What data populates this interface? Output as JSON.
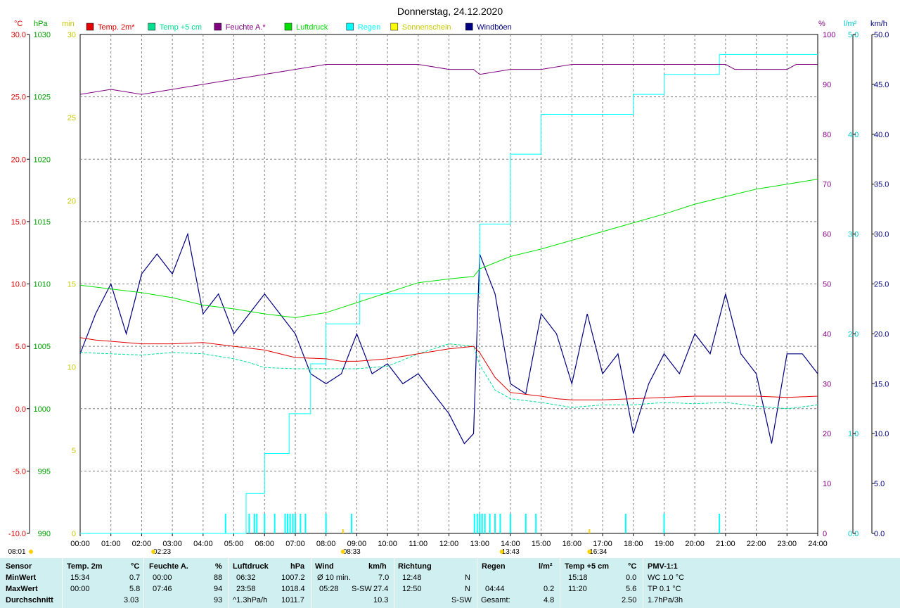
{
  "title": "Donnerstag, 24.12.2020",
  "legend": [
    {
      "label": "Temp. 2m*",
      "color": "#e00000"
    },
    {
      "label": "Temp +5 cm",
      "color": "#00e090"
    },
    {
      "label": "Feuchte A.*",
      "color": "#800080"
    },
    {
      "label": "Luftdruck",
      "color": "#00e000"
    },
    {
      "label": "Regen",
      "color": "#00ffff"
    },
    {
      "label": "Sonnenschein",
      "color": "#ffff00"
    },
    {
      "label": "Windböen",
      "color": "#000080"
    }
  ],
  "units": {
    "temp": "°C",
    "pressure": "hPa",
    "sun": "min",
    "humidity": "%",
    "rain": "l/m²",
    "wind": "km/h"
  },
  "axes": {
    "temp_ticks": [
      "30.0",
      "25.0",
      "20.0",
      "15.0",
      "10.0",
      "5.0",
      "0.0",
      "-5.0",
      "-10.0"
    ],
    "pressure_ticks": [
      "1030",
      "1025",
      "1020",
      "1015",
      "1010",
      "1005",
      "1000",
      "995",
      "990"
    ],
    "sun_ticks": [
      "30",
      "25",
      "20",
      "15",
      "10",
      "5",
      "0"
    ],
    "humidity_ticks": [
      "100",
      "90",
      "80",
      "70",
      "60",
      "50",
      "40",
      "30",
      "20",
      "10",
      "0"
    ],
    "rain_ticks": [
      "5.0",
      "4.0",
      "3.0",
      "2.0",
      "1.0",
      "0.0"
    ],
    "wind_ticks": [
      "50.0",
      "45.0",
      "40.0",
      "35.0",
      "30.0",
      "25.0",
      "20.0",
      "15.0",
      "10.0",
      "5.0",
      "0.0"
    ],
    "time_ticks": [
      "00:00",
      "01:00",
      "02:00",
      "03:00",
      "04:00",
      "05:00",
      "06:00",
      "07:00",
      "08:00",
      "09:00",
      "10:00",
      "11:00",
      "12:00",
      "13:00",
      "14:00",
      "15:00",
      "16:00",
      "17:00",
      "18:00",
      "19:00",
      "20:00",
      "21:00",
      "22:00",
      "23:00",
      "24:00"
    ]
  },
  "time_markers": [
    {
      "label": "08:01",
      "hour": -1
    },
    {
      "label": "02:23",
      "hour": 2.38
    },
    {
      "label": "08:33",
      "hour": 8.55
    },
    {
      "label": "13:43",
      "hour": 13.72
    },
    {
      "label": "16:34",
      "hour": 16.57
    }
  ],
  "chart_data": {
    "type": "line",
    "title": "Donnerstag, 24.12.2020",
    "x_range": [
      "00:00",
      "24:00"
    ],
    "series": [
      {
        "name": "Temp. 2m*",
        "unit": "°C",
        "points": [
          [
            0,
            5.7
          ],
          [
            0.5,
            5.5
          ],
          [
            1,
            5.4
          ],
          [
            2,
            5.2
          ],
          [
            3,
            5.2
          ],
          [
            4,
            5.3
          ],
          [
            5,
            5.0
          ],
          [
            6,
            4.7
          ],
          [
            7,
            4.1
          ],
          [
            8,
            4.0
          ],
          [
            8.5,
            3.8
          ],
          [
            9,
            3.8
          ],
          [
            10,
            4.0
          ],
          [
            11,
            4.4
          ],
          [
            12,
            4.8
          ],
          [
            12.8,
            5.0
          ],
          [
            13,
            4.5
          ],
          [
            13.5,
            2.5
          ],
          [
            14,
            1.3
          ],
          [
            15,
            1.0
          ],
          [
            15.5,
            0.8
          ],
          [
            16,
            0.7
          ],
          [
            17,
            0.7
          ],
          [
            18,
            0.8
          ],
          [
            19,
            0.9
          ],
          [
            20,
            1.0
          ],
          [
            21,
            1.0
          ],
          [
            22,
            1.0
          ],
          [
            23,
            0.9
          ],
          [
            24,
            1.0
          ]
        ]
      },
      {
        "name": "Temp +5 cm",
        "unit": "°C",
        "points": [
          [
            0,
            4.5
          ],
          [
            1,
            4.4
          ],
          [
            2,
            4.3
          ],
          [
            3,
            4.5
          ],
          [
            4,
            4.4
          ],
          [
            5,
            4.0
          ],
          [
            5.5,
            3.7
          ],
          [
            6,
            3.3
          ],
          [
            7,
            3.2
          ],
          [
            8,
            3.2
          ],
          [
            9,
            3.2
          ],
          [
            10,
            3.4
          ],
          [
            11,
            4.4
          ],
          [
            12,
            5.2
          ],
          [
            12.8,
            5.0
          ],
          [
            13,
            3.5
          ],
          [
            13.5,
            1.5
          ],
          [
            14,
            0.8
          ],
          [
            15,
            0.5
          ],
          [
            16,
            0.1
          ],
          [
            17,
            0.3
          ],
          [
            18,
            0.3
          ],
          [
            19,
            0.5
          ],
          [
            20,
            0.4
          ],
          [
            21,
            0.5
          ],
          [
            22,
            0.2
          ],
          [
            23,
            0.0
          ],
          [
            24,
            0.3
          ]
        ]
      },
      {
        "name": "Feuchte A.*",
        "unit": "%",
        "points": [
          [
            0,
            88
          ],
          [
            1,
            89
          ],
          [
            2,
            88
          ],
          [
            3,
            89
          ],
          [
            4,
            90
          ],
          [
            5,
            91
          ],
          [
            6,
            92
          ],
          [
            7,
            93
          ],
          [
            8,
            94
          ],
          [
            9,
            94
          ],
          [
            10,
            94
          ],
          [
            11,
            94
          ],
          [
            12,
            93
          ],
          [
            12.8,
            93
          ],
          [
            13,
            92
          ],
          [
            14,
            93
          ],
          [
            15,
            93
          ],
          [
            16,
            94
          ],
          [
            17,
            94
          ],
          [
            18,
            94
          ],
          [
            19,
            94
          ],
          [
            20,
            94
          ],
          [
            21,
            94
          ],
          [
            21.3,
            93
          ],
          [
            22,
            93
          ],
          [
            23,
            93
          ],
          [
            23.3,
            94
          ],
          [
            24,
            94
          ]
        ]
      },
      {
        "name": "Luftdruck",
        "unit": "hPa",
        "points": [
          [
            0,
            1009.9
          ],
          [
            1,
            1009.6
          ],
          [
            2,
            1009.3
          ],
          [
            3,
            1008.9
          ],
          [
            4,
            1008.3
          ],
          [
            5,
            1008.0
          ],
          [
            6,
            1007.6
          ],
          [
            7,
            1007.3
          ],
          [
            8,
            1007.7
          ],
          [
            9,
            1008.5
          ],
          [
            10,
            1009.3
          ],
          [
            11,
            1010.1
          ],
          [
            12,
            1010.4
          ],
          [
            12.8,
            1010.6
          ],
          [
            13,
            1011.2
          ],
          [
            14,
            1012.2
          ],
          [
            15,
            1012.8
          ],
          [
            16,
            1013.5
          ],
          [
            17,
            1014.2
          ],
          [
            18,
            1014.9
          ],
          [
            19,
            1015.6
          ],
          [
            20,
            1016.4
          ],
          [
            21,
            1017.0
          ],
          [
            22,
            1017.6
          ],
          [
            23,
            1018.0
          ],
          [
            24,
            1018.4
          ]
        ]
      },
      {
        "name": "Regen",
        "unit": "l/m²",
        "points": [
          [
            0,
            0
          ],
          [
            4.73,
            0
          ],
          [
            5.4,
            0.4
          ],
          [
            6.0,
            0.8
          ],
          [
            6.8,
            1.2
          ],
          [
            7.5,
            1.7
          ],
          [
            8.0,
            2.1
          ],
          [
            9.0,
            2.1
          ],
          [
            9.1,
            2.4
          ],
          [
            12.8,
            2.4
          ],
          [
            13.0,
            3.1
          ],
          [
            14.0,
            3.8
          ],
          [
            15.0,
            4.2
          ],
          [
            18.0,
            4.4
          ],
          [
            19.0,
            4.6
          ],
          [
            20.8,
            4.8
          ],
          [
            24,
            4.8
          ]
        ]
      },
      {
        "name": "Windböen",
        "unit": "km/h",
        "points": [
          [
            0,
            18
          ],
          [
            0.5,
            22
          ],
          [
            1,
            25
          ],
          [
            1.5,
            20
          ],
          [
            2,
            26
          ],
          [
            2.5,
            28
          ],
          [
            3,
            26
          ],
          [
            3.5,
            30
          ],
          [
            4,
            22
          ],
          [
            4.5,
            24
          ],
          [
            5,
            20
          ],
          [
            5.5,
            22
          ],
          [
            6,
            24
          ],
          [
            6.5,
            22
          ],
          [
            7,
            20
          ],
          [
            7.5,
            16
          ],
          [
            8,
            15
          ],
          [
            8.5,
            16
          ],
          [
            9,
            20
          ],
          [
            9.5,
            16
          ],
          [
            10,
            17
          ],
          [
            10.5,
            15
          ],
          [
            11,
            16
          ],
          [
            11.5,
            14
          ],
          [
            12,
            12
          ],
          [
            12.5,
            9
          ],
          [
            12.8,
            10
          ],
          [
            13,
            28
          ],
          [
            13.5,
            24
          ],
          [
            14,
            15
          ],
          [
            14.5,
            14
          ],
          [
            15,
            22
          ],
          [
            15.5,
            20
          ],
          [
            16,
            15
          ],
          [
            16.5,
            22
          ],
          [
            17,
            16
          ],
          [
            17.5,
            18
          ],
          [
            18,
            10
          ],
          [
            18.5,
            15
          ],
          [
            19,
            18
          ],
          [
            19.5,
            16
          ],
          [
            20,
            20
          ],
          [
            20.5,
            18
          ],
          [
            21,
            24
          ],
          [
            21.5,
            18
          ],
          [
            22,
            16
          ],
          [
            22.5,
            9
          ],
          [
            23,
            18
          ],
          [
            23.5,
            18
          ],
          [
            24,
            16
          ]
        ]
      }
    ],
    "rain_ticks_hours": [
      4.73,
      5.5,
      5.67,
      5.75,
      6.0,
      6.33,
      6.67,
      6.75,
      6.83,
      6.92,
      7.0,
      7.17,
      7.33,
      8.0,
      8.83,
      12.83,
      12.92,
      13.0,
      13.08,
      13.17,
      13.33,
      13.5,
      13.67,
      14.0,
      14.5,
      14.83,
      17.75,
      19.0,
      20.8
    ],
    "sun_ticks_hours": [
      8.55,
      16.57
    ]
  },
  "stats": {
    "headers": {
      "sensor": "Sensor",
      "temp": "Temp. 2m",
      "temp_unit": "°C",
      "hum": "Feuchte A.",
      "hum_unit": "%",
      "press": "Luftdruck",
      "press_unit": "hPa",
      "wind": "Wind",
      "wind_unit": "km/h",
      "dir": "Richtung",
      "rain": "Regen",
      "rain_unit": "l/m²",
      "t5": "Temp +5 cm",
      "t5_unit": "°C",
      "pmv": "PMV-1:1"
    },
    "rows": {
      "min": "MinWert",
      "max": "MaxWert",
      "avg": "Durchschnitt"
    },
    "temp": {
      "min_time": "15:34",
      "min": "0.7",
      "max_time": "00:00",
      "max": "5.8",
      "avg": "3.03"
    },
    "hum": {
      "min_time": "00:00",
      "min": "88",
      "max_time": "07:46",
      "max": "94",
      "avg": "93"
    },
    "press": {
      "min_time": "06:32",
      "min": "1007.2",
      "max_time": "23:58",
      "max": "1018.4",
      "avg_label": "^1.3hPa/h",
      "avg": "1011.7"
    },
    "wind": {
      "min_label": "Ø 10 min.",
      "min": "7.0",
      "max_time": "05:28",
      "max_dir": "S-SW",
      "max": "27.4",
      "avg": "10.3"
    },
    "dir": {
      "min_time": "12:48",
      "min": "N",
      "max_time": "12:50",
      "max": "N",
      "avg": "S-SW"
    },
    "rain": {
      "max_time": "04:44",
      "max": "0.2",
      "total_label": "Gesamt:",
      "total": "4.8"
    },
    "t5": {
      "min_time": "15:18",
      "min": "0.0",
      "max_time": "11:20",
      "max": "5.6",
      "avg": "2.50"
    },
    "pmv": {
      "wc": "WC 1.0 °C",
      "tp": "TP 0.1 °C",
      "trend": "1.7hPa/3h"
    }
  }
}
